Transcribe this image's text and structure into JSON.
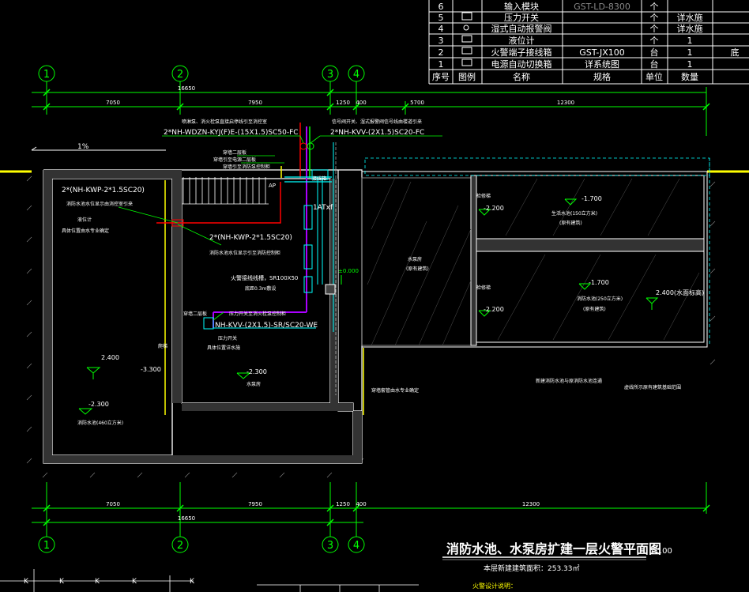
{
  "legend_table": {
    "headers": [
      "序号",
      "图例",
      "名称",
      "规格",
      "单位",
      "数量"
    ],
    "rows": [
      {
        "no": "6",
        "name": "输入模块",
        "spec": "GST-LD-8300",
        "unit": "个",
        "qty": ""
      },
      {
        "no": "5",
        "name": "压力开关",
        "spec": "",
        "unit": "个",
        "qty": "详水施"
      },
      {
        "no": "4",
        "name": "湿式自动报警阀",
        "spec": "",
        "unit": "个",
        "qty": "详水施"
      },
      {
        "no": "3",
        "name": "液位计",
        "spec": "",
        "unit": "个",
        "qty": "1"
      },
      {
        "no": "2",
        "name": "火警端子接线箱",
        "spec": "GST-JX100",
        "unit": "台",
        "qty": "1"
      },
      {
        "no": "1",
        "name": "电源自动切换箱",
        "spec": "详系统图",
        "unit": "台",
        "qty": "1"
      }
    ],
    "extra_note": "底"
  },
  "axes": {
    "labels": [
      "1",
      "2",
      "3",
      "4"
    ]
  },
  "dimensions": {
    "top": [
      "7050",
      "7950",
      "1250",
      "400",
      "5700",
      "12300"
    ],
    "top_total": "16650",
    "bottom": [
      "7050",
      "7950",
      "1250",
      "400",
      "12300"
    ],
    "bottom_total": "16650"
  },
  "annotations": {
    "top_left_note": "喷淋泵、消火栓泵直接启停线引至消控室",
    "top_left_cable": "2*NH-WDZN-KYJ(F)E-(15X1.5)SC50-FC",
    "top_right_note": "信号阀开关、湿式报警阀信号线由楼道引来",
    "top_right_cable": "2*NH-KVV-(2X1.5)SC20-FC",
    "slope": "1%",
    "left_cable": "2*(NH-KWP-2*1.5SC20)",
    "left_note": "消防水池水位显示由消控室引来",
    "level_meter": "液位计",
    "level_meter_note": "具体位置由水专业确定",
    "mid_cable": "2*(NH-KWP-2*1.5SC20)",
    "mid_note": "消防水池水位显示引至消防控制柜",
    "stair_note_1": "穿墙二层板",
    "stair_note_2": "穿墙引至电源二层板",
    "stair_note_3": "穿墙引至消防泵控制柜",
    "box_1at": "1ATxf",
    "box_label": "接线箱",
    "box_ap": "AP",
    "pipe_note": "火警接线线槽，SR100X50",
    "pipe_note_2": "底距0.3m敷设",
    "pressure_note": "压力开关至消火栓泵控制柜",
    "kvv_cable": "NH-KVV-(2X1.5)-SR/SC20-WE",
    "pressure_switch": "压力开关",
    "pressure_switch_note": "具体位置详水施",
    "wall_note": "穿墙二层板",
    "elev_pool": "2.400",
    "elev_pool_neg": "-3.300",
    "elev_floor": "-2.300",
    "pool_name": "消防水池(460立方米)",
    "elev_pool_low": "-2.300",
    "room_name": "水泵房",
    "zero": "±0.000",
    "ladder_label": "爬梯",
    "wall_ref": "穿墙套管由水专业确定",
    "pump_room": "水泵房",
    "pump_room_sub": "(原有建筑)",
    "r1_elev": "-1.700",
    "r1_name": "生活水池(150立方米)",
    "r1_sub": "(原有建筑)",
    "r1_low": "-2.200",
    "r2_elev": "-1.700",
    "r2_name": "消防水池(250立方米)",
    "r2_sub": "(原有建筑)",
    "r2_low": "-2.200",
    "r2_right": "2.400(水面标高)",
    "ladder_a": "检修梯",
    "ladder_b": "检修梯",
    "bottom_note_1": "新建消防水池与原消防水池连通",
    "bottom_note_2": "虚线所示原有建筑基础范围"
  },
  "title": {
    "main": "消防水池、水泵房扩建一层火警平面图",
    "scale": "1:100",
    "area": "本层新建建筑面积：253.33㎡",
    "notes_heading": "火警设计说明："
  },
  "bottom_table": {
    "headers": [
      "",
      ""
    ]
  }
}
